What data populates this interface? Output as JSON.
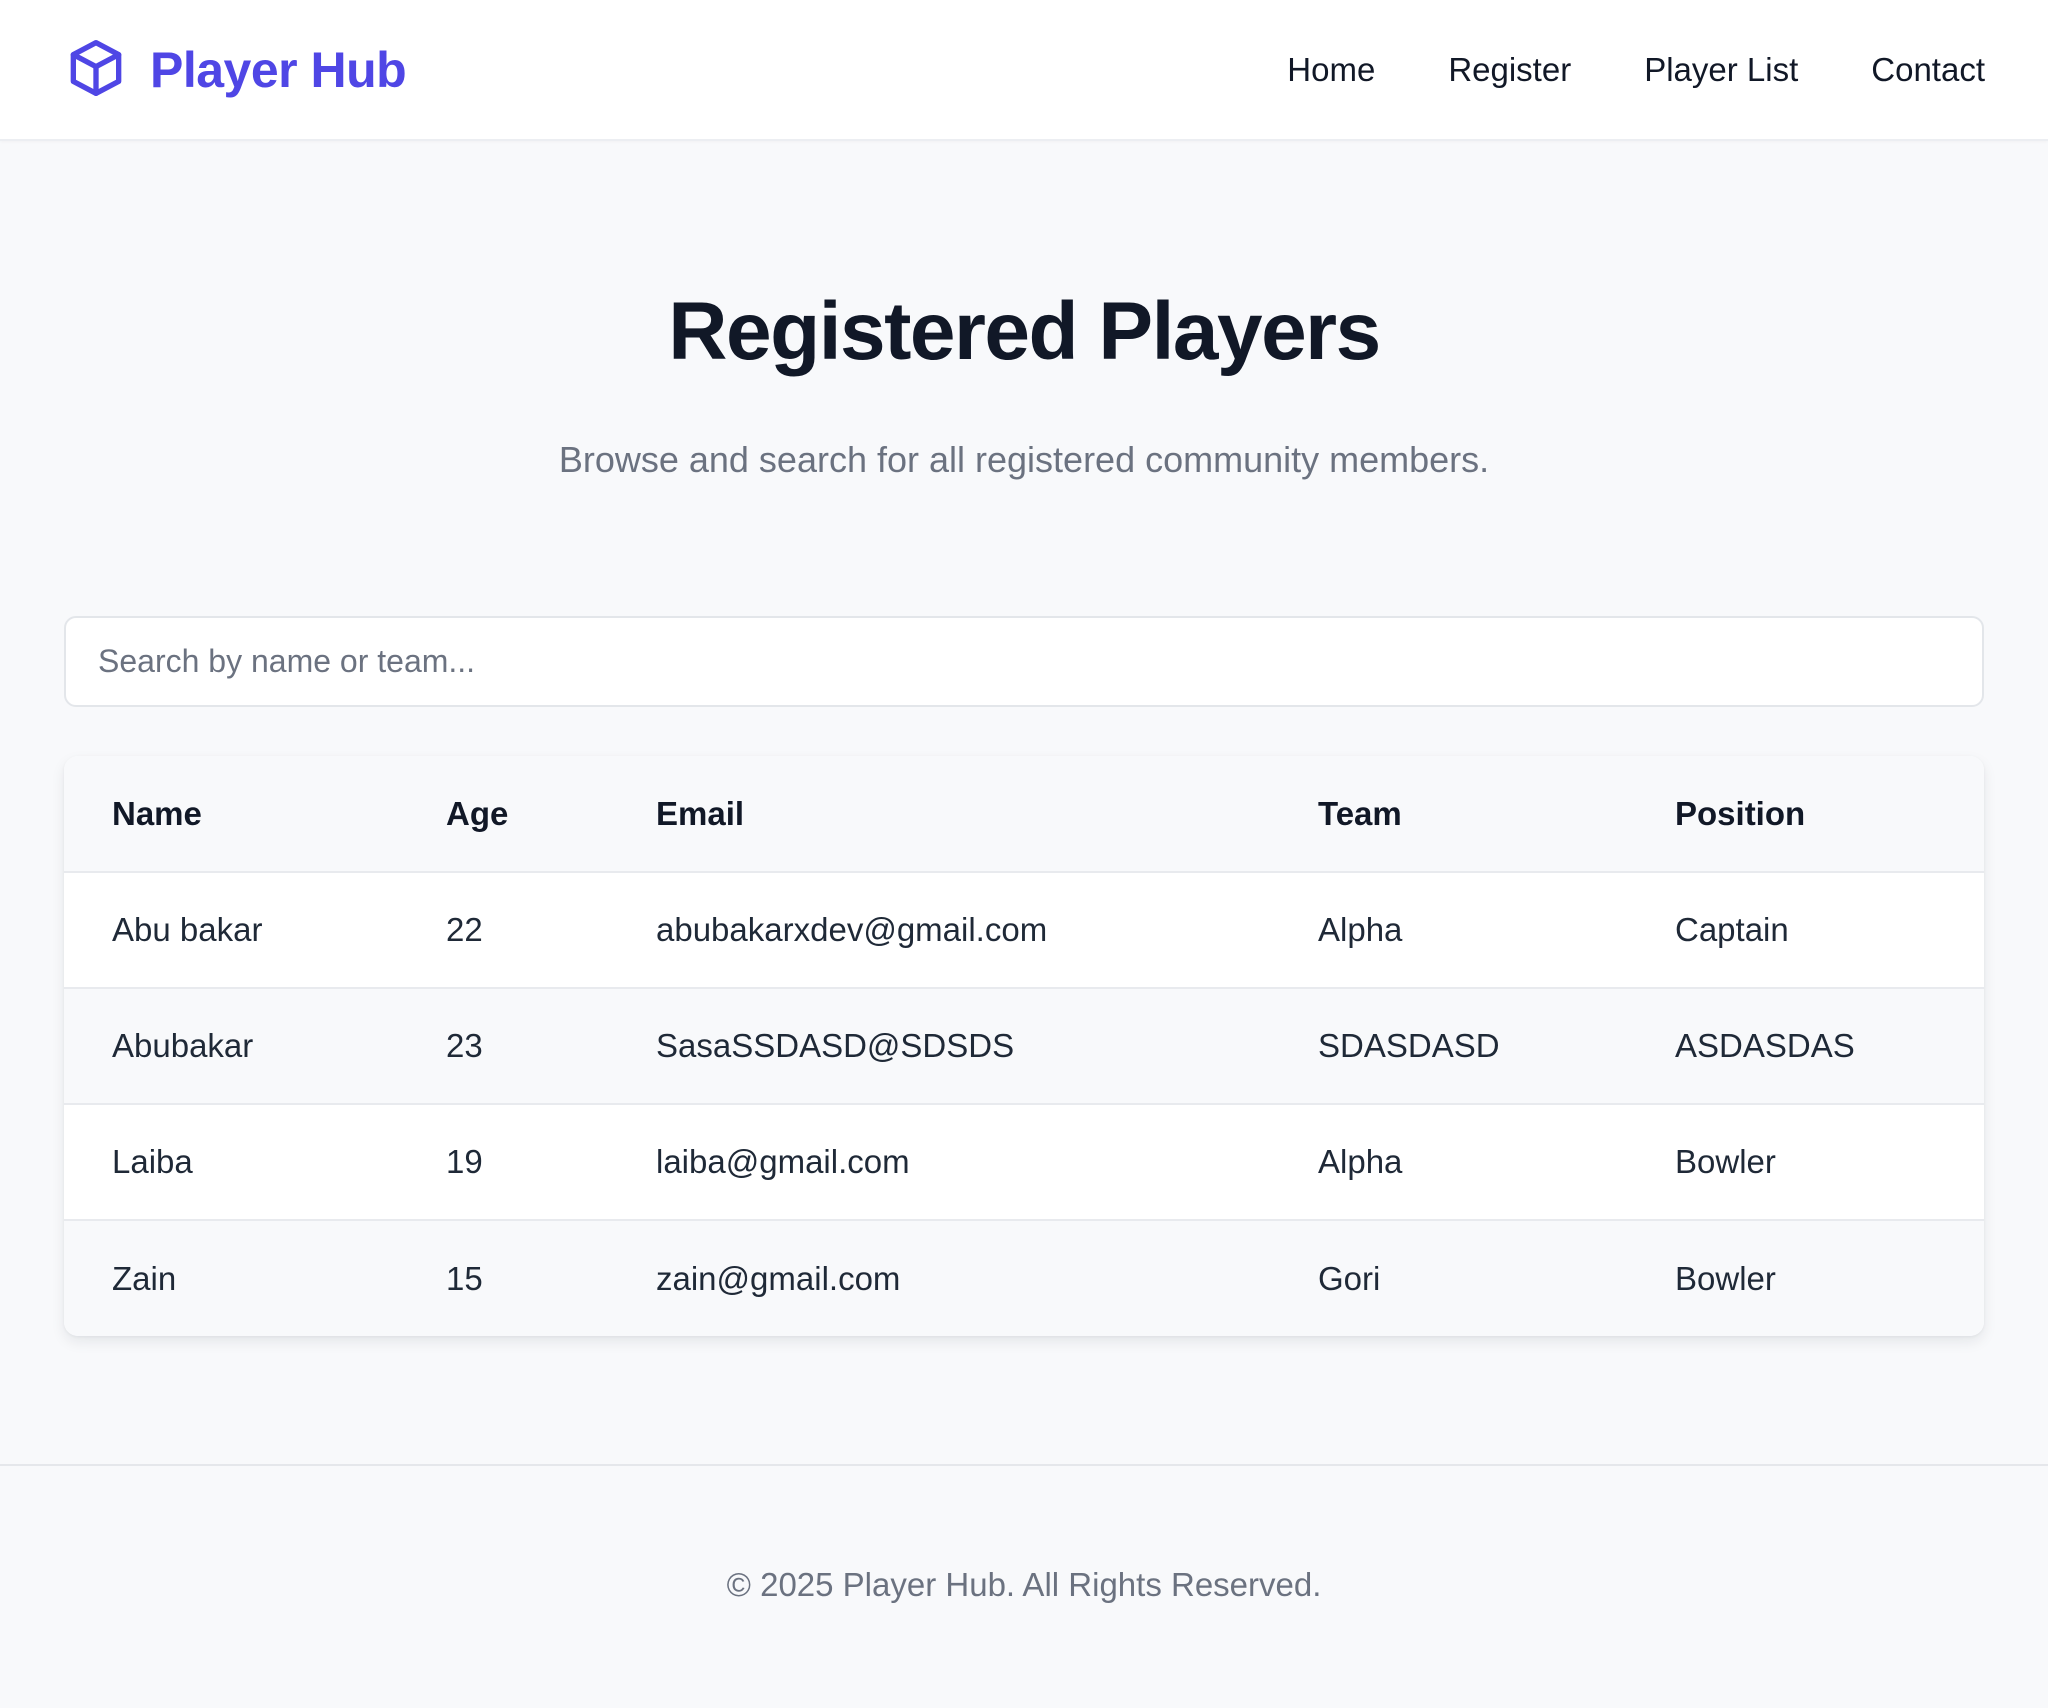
{
  "brand": {
    "name": "Player Hub",
    "icon": "cube-icon",
    "accent_color": "#4f46e5"
  },
  "nav": {
    "items": [
      {
        "label": "Home"
      },
      {
        "label": "Register"
      },
      {
        "label": "Player List"
      },
      {
        "label": "Contact"
      }
    ]
  },
  "hero": {
    "title": "Registered Players",
    "subtitle": "Browse and search for all registered community members."
  },
  "search": {
    "placeholder": "Search by name or team...",
    "value": ""
  },
  "table": {
    "columns": [
      "Name",
      "Age",
      "Email",
      "Team",
      "Position"
    ],
    "rows": [
      [
        "Abu bakar",
        "22",
        "abubakarxdev@gmail.com",
        "Alpha",
        "Captain"
      ],
      [
        "Abubakar",
        "23",
        "SasaSSDASD@SDSDS",
        "SDASDASD",
        "ASDASDAS"
      ],
      [
        "Laiba",
        "19",
        "laiba@gmail.com",
        "Alpha",
        "Bowler"
      ],
      [
        "Zain",
        "15",
        "zain@gmail.com",
        "Gori",
        "Bowler"
      ]
    ]
  },
  "footer": {
    "text": "© 2025 Player Hub. All Rights Reserved."
  }
}
